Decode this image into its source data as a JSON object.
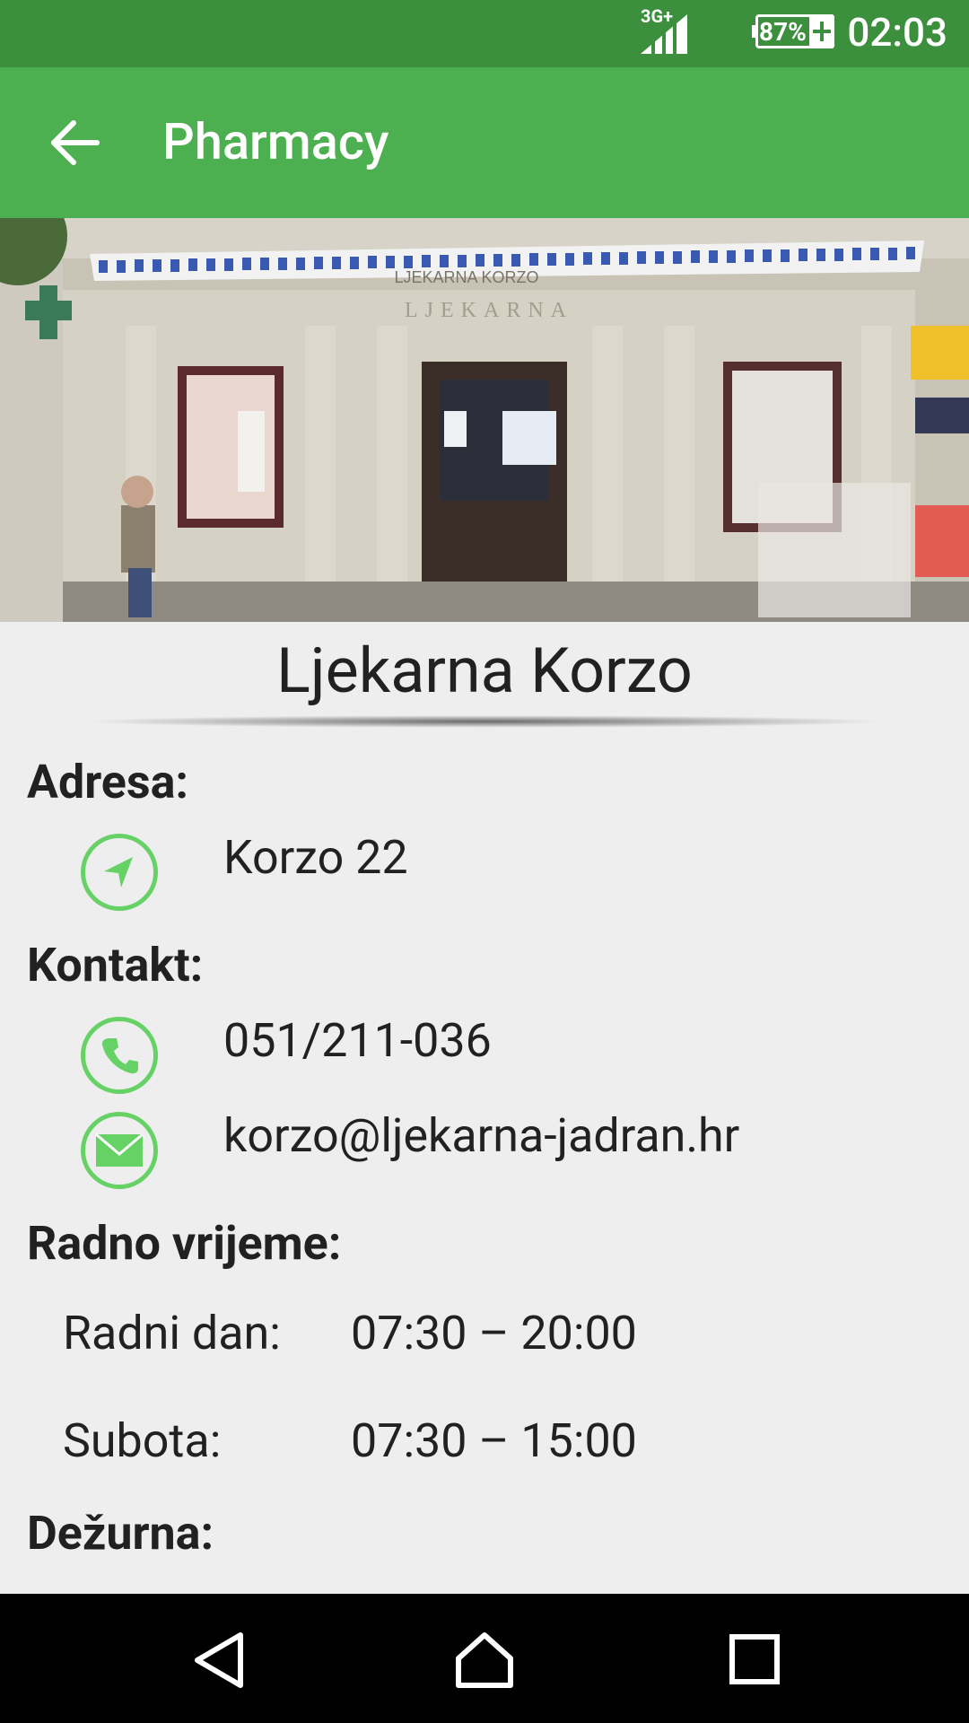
{
  "status_bar": {
    "network": "3G+",
    "battery": "87%",
    "time": "02:03"
  },
  "app_bar": {
    "back_icon": "arrow-left-icon",
    "title": "Pharmacy"
  },
  "photo": {
    "storefront_sign": "LJEKARNA KORZO",
    "facade_lettering": "LJEKARNA"
  },
  "pharmacy": {
    "name": "Ljekarna Korzo"
  },
  "address": {
    "label": "Adresa:",
    "icon": "navigation-arrow-icon",
    "value": "Korzo 22"
  },
  "contact": {
    "label": "Kontakt:",
    "phone_icon": "phone-icon",
    "phone": "051/211-036",
    "email_icon": "envelope-icon",
    "email": "korzo@ljekarna-jadran.hr"
  },
  "hours": {
    "label": "Radno vrijeme:",
    "rows": [
      {
        "day": "Radni dan:",
        "time": "07:30 – 20:00"
      },
      {
        "day": "Subota:",
        "time": "07:30 – 15:00"
      }
    ]
  },
  "on_duty": {
    "label": "Dežurna:"
  },
  "nav_bar": {
    "back": "triangle-back-icon",
    "home": "home-icon",
    "recents": "square-recents-icon"
  },
  "colors": {
    "status_bar": "#3c8f3c",
    "app_bar": "#4caf50",
    "icon_accent": "#66d266",
    "background": "#eeeeee"
  }
}
